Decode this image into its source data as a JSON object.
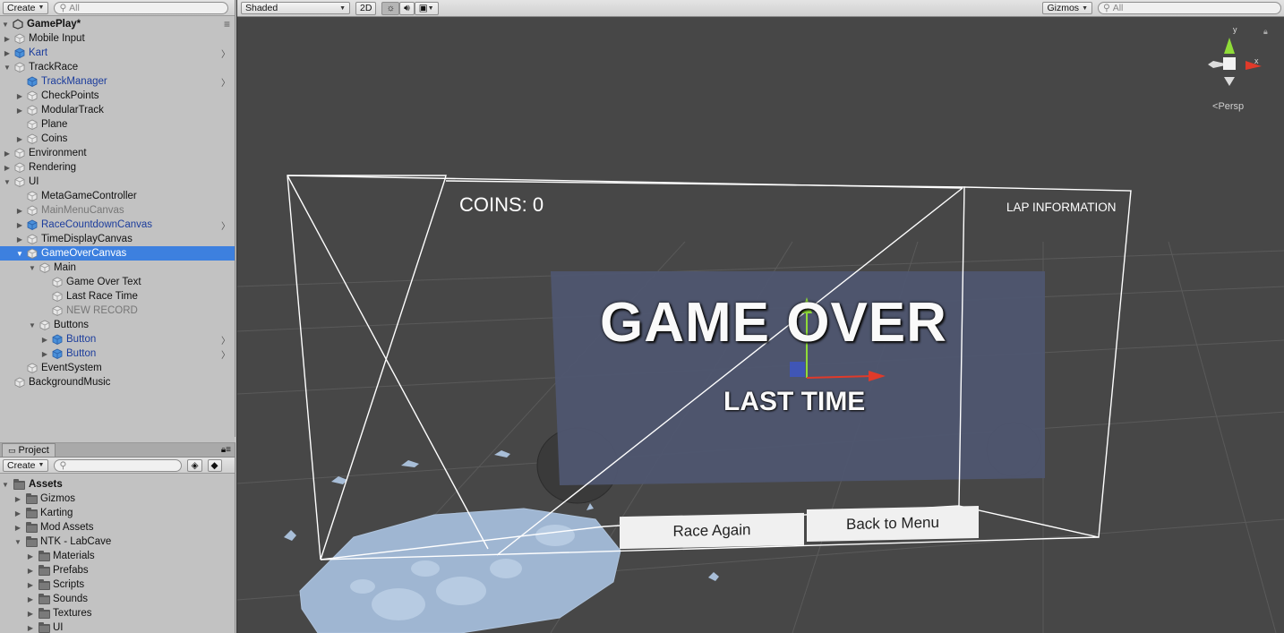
{
  "hierarchy": {
    "create_label": "Create",
    "search_placeholder": "All",
    "scene_name": "GamePlay*",
    "items": [
      {
        "label": "Mobile Input"
      },
      {
        "label": "Kart"
      },
      {
        "label": "TrackRace"
      },
      {
        "label": "TrackManager"
      },
      {
        "label": "CheckPoints"
      },
      {
        "label": "ModularTrack"
      },
      {
        "label": "Plane"
      },
      {
        "label": "Coins"
      },
      {
        "label": "Environment"
      },
      {
        "label": "Rendering"
      },
      {
        "label": "UI"
      },
      {
        "label": "MetaGameController"
      },
      {
        "label": "MainMenuCanvas"
      },
      {
        "label": "RaceCountdownCanvas"
      },
      {
        "label": "TimeDisplayCanvas"
      },
      {
        "label": "GameOverCanvas"
      },
      {
        "label": "Main"
      },
      {
        "label": "Game Over Text"
      },
      {
        "label": "Last Race Time"
      },
      {
        "label": "NEW RECORD"
      },
      {
        "label": "Buttons"
      },
      {
        "label": "Button"
      },
      {
        "label": "Button"
      },
      {
        "label": "EventSystem"
      },
      {
        "label": "BackgroundMusic"
      }
    ]
  },
  "project": {
    "tab_label": "Project",
    "create_label": "Create",
    "root_label": "Assets",
    "folders": [
      {
        "label": "Gizmos"
      },
      {
        "label": "Karting"
      },
      {
        "label": "Mod Assets"
      },
      {
        "label": "NTK - LabCave"
      },
      {
        "label": "Materials"
      },
      {
        "label": "Prefabs"
      },
      {
        "label": "Scripts"
      },
      {
        "label": "Sounds"
      },
      {
        "label": "Textures"
      },
      {
        "label": "UI"
      }
    ]
  },
  "scene_toolbar": {
    "draw_mode": "Shaded",
    "mode_2d": "2D",
    "gizmos_label": "Gizmos",
    "search_placeholder": "All"
  },
  "scene": {
    "coins_text": "COINS: 0",
    "lap_info_text": "LAP INFORMATION",
    "game_over_text": "GAME OVER",
    "last_time_text": "LAST TIME",
    "race_again_label": "Race Again",
    "back_to_menu_label": "Back to Menu",
    "persp_label": "Persp",
    "axis_y": "y",
    "axis_x": "x"
  },
  "colors": {
    "selection": "#3d80df",
    "prefab_text": "#1b3c9c",
    "scene_bg": "#474747",
    "terrain": "#9fb6d2"
  }
}
